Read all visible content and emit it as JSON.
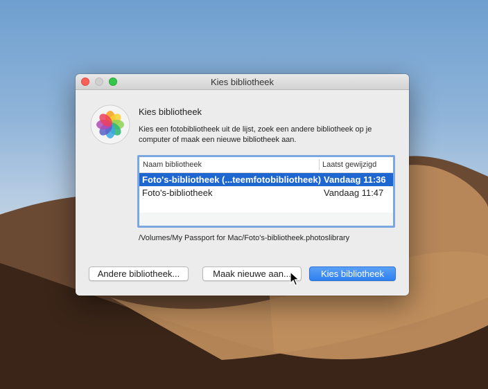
{
  "window": {
    "title": "Kies bibliotheek"
  },
  "dialog": {
    "icon": "photos-app-icon",
    "heading": "Kies bibliotheek",
    "description": "Kies een fotobibliotheek uit de lijst, zoek een andere bibliotheek op je computer of maak een nieuwe bibliotheek aan."
  },
  "table": {
    "columns": [
      "Naam bibliotheek",
      "Laatst gewijzigd"
    ],
    "rows": [
      {
        "name": "Foto's-bibliotheek (...teemfotobibliotheek)",
        "modified": "Vandaag 11:36",
        "selected": true
      },
      {
        "name": "Foto's-bibliotheek",
        "modified": "Vandaag 11:47",
        "selected": false
      }
    ]
  },
  "selected_path": "/Volumes/My Passport for Mac/Foto's-bibliotheek.photoslibrary",
  "buttons": {
    "other": "Andere bibliotheek...",
    "new": "Maak nieuwe aan...",
    "choose": "Kies bibliotheek"
  },
  "colors": {
    "accent": "#1e66d0",
    "close": "#fc5f57",
    "zoom": "#34c749"
  }
}
